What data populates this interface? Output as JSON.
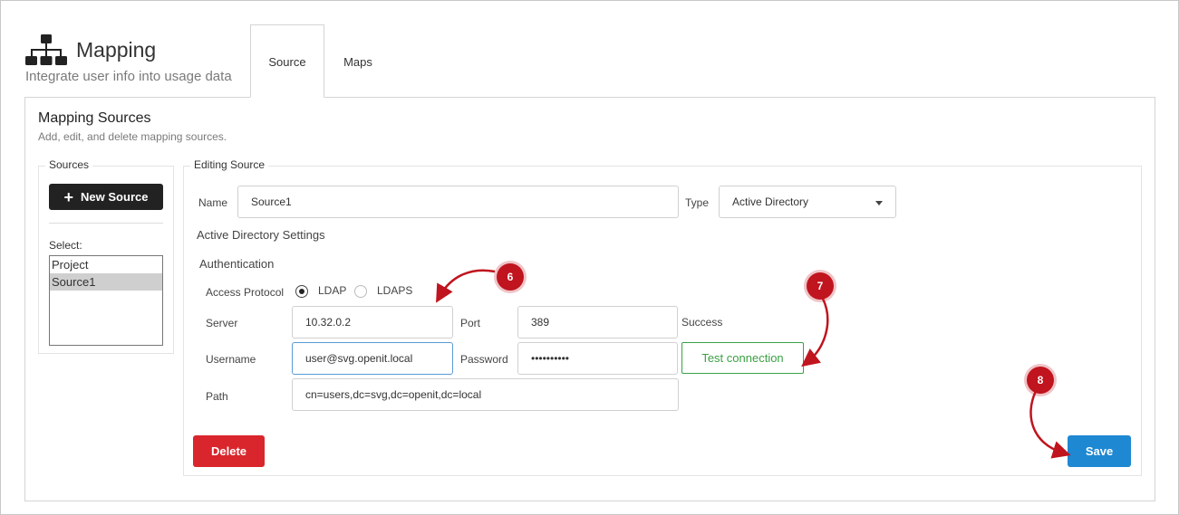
{
  "header": {
    "title": "Mapping",
    "subtitle": "Integrate user info into usage data",
    "icon": "sitemap-icon"
  },
  "tabs": [
    {
      "label": "Source",
      "active": true
    },
    {
      "label": "Maps",
      "active": false
    }
  ],
  "panel": {
    "title": "Mapping Sources",
    "subtitle": "Add, edit, and delete mapping sources."
  },
  "sources": {
    "legend": "Sources",
    "new_button": "New Source",
    "select_label": "Select:",
    "items": [
      "Project",
      "Source1"
    ],
    "selected": "Source1"
  },
  "editing": {
    "legend": "Editing Source",
    "name_label": "Name",
    "name_value": "Source1",
    "type_label": "Type",
    "type_value": "Active Directory",
    "ad_settings_label": "Active Directory Settings",
    "authentication_label": "Authentication",
    "access_protocol_label": "Access Protocol",
    "protocol_options": [
      "LDAP",
      "LDAPS"
    ],
    "protocol_selected": "LDAP",
    "server_label": "Server",
    "server_value": "10.32.0.2",
    "port_label": "Port",
    "port_value": "389",
    "status_text": "Success",
    "username_label": "Username",
    "username_value": "user@svg.openit.local",
    "password_label": "Password",
    "password_value": "••••••••••",
    "test_button": "Test connection",
    "path_label": "Path",
    "path_value": "cn=users,dc=svg,dc=openit,dc=local",
    "delete_button": "Delete",
    "save_button": "Save"
  },
  "annotations": [
    "6",
    "7",
    "8"
  ],
  "colors": {
    "annotation": "#c0141e",
    "delete": "#d9262c",
    "save": "#1e88d2",
    "test": "#3aa145"
  }
}
